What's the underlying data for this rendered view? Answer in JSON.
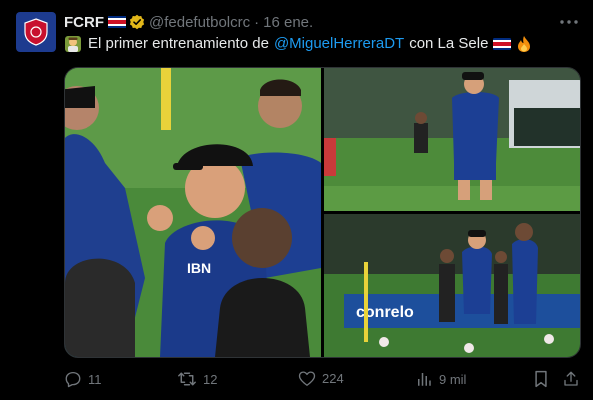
{
  "tweet": {
    "author_name": "FCRF",
    "handle": "@fedefutbolcrc",
    "separator": "·",
    "time": "16 ene.",
    "text_before": "El primer entrenamiento de",
    "mention": "@MiguelHerreraDT",
    "text_after": "con La Sele",
    "emojis": [
      "coach-emoji",
      "costa-rica-flag-emoji",
      "fire-emoji"
    ]
  },
  "media": {
    "photos": [
      {
        "name": "coach-talking-photo",
        "logo_text": "IBN"
      },
      {
        "name": "coach-walking-field-photo"
      },
      {
        "name": "coach-training-players-photo",
        "banner_text": "conrelo"
      }
    ]
  },
  "actions": {
    "replies": "11",
    "reposts": "12",
    "likes": "224",
    "views": "9 mil"
  },
  "colors": {
    "background": "#000000",
    "text": "#e7e9ea",
    "muted": "#71767b",
    "link": "#1d9bf0",
    "verified": "#e2b719"
  }
}
